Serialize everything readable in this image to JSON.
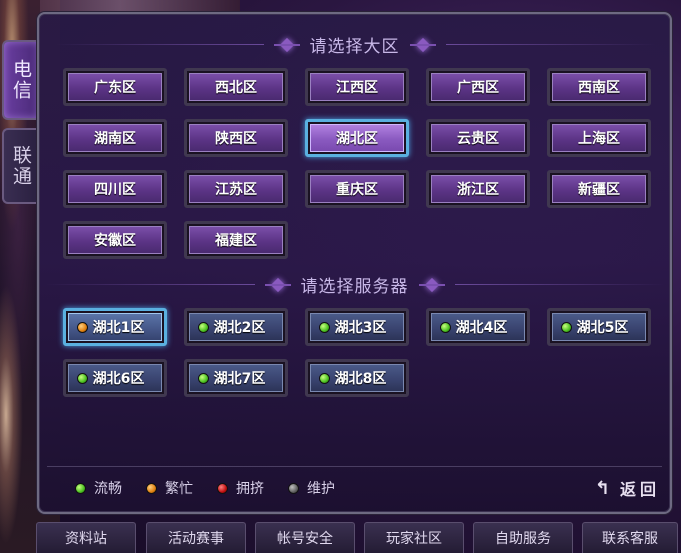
{
  "side_tabs": [
    {
      "label": "电信",
      "active": true
    },
    {
      "label": "联通",
      "active": false
    }
  ],
  "region_section": {
    "title": "请选择大区",
    "regions": [
      "广东区",
      "西北区",
      "江西区",
      "广西区",
      "西南区",
      "湖南区",
      "陕西区",
      "湖北区",
      "云贵区",
      "上海区",
      "四川区",
      "江苏区",
      "重庆区",
      "浙江区",
      "新疆区",
      "安徽区",
      "福建区"
    ],
    "selected": "湖北区"
  },
  "server_section": {
    "title": "请选择服务器",
    "servers": [
      {
        "label": "湖北1区",
        "status": "orange"
      },
      {
        "label": "湖北2区",
        "status": "green"
      },
      {
        "label": "湖北3区",
        "status": "green"
      },
      {
        "label": "湖北4区",
        "status": "green"
      },
      {
        "label": "湖北5区",
        "status": "green"
      },
      {
        "label": "湖北6区",
        "status": "green"
      },
      {
        "label": "湖北7区",
        "status": "green"
      },
      {
        "label": "湖北8区",
        "status": "green"
      }
    ],
    "selected": "湖北1区"
  },
  "legend": [
    {
      "label": "流畅",
      "color": "green"
    },
    {
      "label": "繁忙",
      "color": "orange"
    },
    {
      "label": "拥挤",
      "color": "red"
    },
    {
      "label": "维护",
      "color": "gray"
    }
  ],
  "back_label": "返回",
  "bottom_nav": [
    "资料站",
    "活动赛事",
    "帐号安全",
    "玩家社区",
    "自助服务",
    "联系客服"
  ],
  "colors": {
    "region_button": "#5c3486",
    "server_button": "#3a4470",
    "selected_glow": "#5ab0e0",
    "status_green": "#4ac020",
    "status_orange": "#e08010",
    "status_red": "#c01010",
    "status_gray": "#606060"
  }
}
